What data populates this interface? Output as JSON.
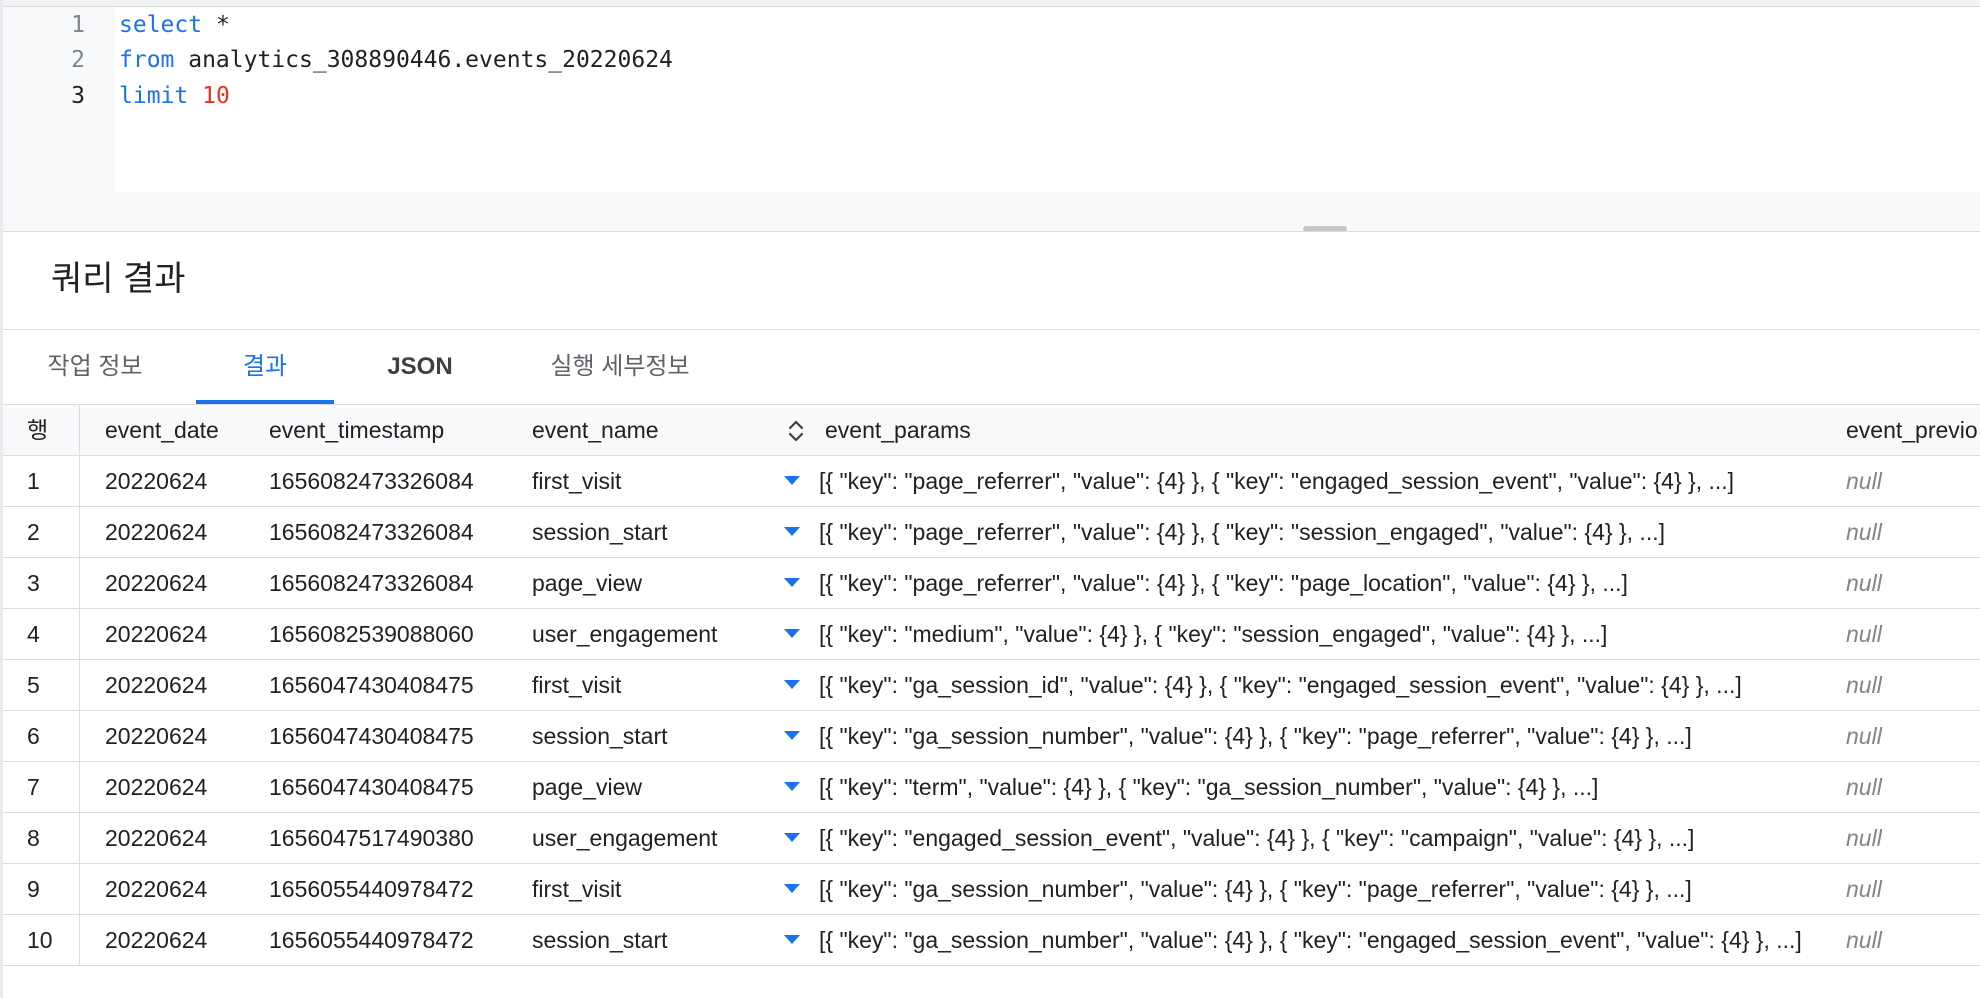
{
  "editor": {
    "lines": [
      {
        "num": "1",
        "kw1": "select",
        "rest": " *",
        "kw2": "",
        "numval": ""
      },
      {
        "num": "2",
        "kw1": "from",
        "rest": " analytics_308890446.events_20220624",
        "kw2": "",
        "numval": ""
      },
      {
        "num": "3",
        "kw1": "limit",
        "rest": " ",
        "kw2": "",
        "numval": "10"
      }
    ]
  },
  "results": {
    "title": "쿼리 결과"
  },
  "tabs": [
    {
      "label": "작업 정보"
    },
    {
      "label": "결과"
    },
    {
      "label": "JSON"
    },
    {
      "label": "실행 세부정보"
    }
  ],
  "table": {
    "headers": {
      "row": "행",
      "event_date": "event_date",
      "event_timestamp": "event_timestamp",
      "event_name": "event_name",
      "event_params": "event_params",
      "event_previous": "event_previo"
    },
    "rows": [
      {
        "row": "1",
        "event_date": "20220624",
        "event_timestamp": "1656082473326084",
        "event_name": "first_visit",
        "event_params": "[{ \"key\": \"page_referrer\", \"value\": {4} }, { \"key\": \"engaged_session_event\", \"value\": {4} }, ...]",
        "event_previous": "null"
      },
      {
        "row": "2",
        "event_date": "20220624",
        "event_timestamp": "1656082473326084",
        "event_name": "session_start",
        "event_params": "[{ \"key\": \"page_referrer\", \"value\": {4} }, { \"key\": \"session_engaged\", \"value\": {4} }, ...]",
        "event_previous": "null"
      },
      {
        "row": "3",
        "event_date": "20220624",
        "event_timestamp": "1656082473326084",
        "event_name": "page_view",
        "event_params": "[{ \"key\": \"page_referrer\", \"value\": {4} }, { \"key\": \"page_location\", \"value\": {4} }, ...]",
        "event_previous": "null"
      },
      {
        "row": "4",
        "event_date": "20220624",
        "event_timestamp": "1656082539088060",
        "event_name": "user_engagement",
        "event_params": "[{ \"key\": \"medium\", \"value\": {4} }, { \"key\": \"session_engaged\", \"value\": {4} }, ...]",
        "event_previous": "null"
      },
      {
        "row": "5",
        "event_date": "20220624",
        "event_timestamp": "1656047430408475",
        "event_name": "first_visit",
        "event_params": "[{ \"key\": \"ga_session_id\", \"value\": {4} }, { \"key\": \"engaged_session_event\", \"value\": {4} }, ...]",
        "event_previous": "null"
      },
      {
        "row": "6",
        "event_date": "20220624",
        "event_timestamp": "1656047430408475",
        "event_name": "session_start",
        "event_params": "[{ \"key\": \"ga_session_number\", \"value\": {4} }, { \"key\": \"page_referrer\", \"value\": {4} }, ...]",
        "event_previous": "null"
      },
      {
        "row": "7",
        "event_date": "20220624",
        "event_timestamp": "1656047430408475",
        "event_name": "page_view",
        "event_params": "[{ \"key\": \"term\", \"value\": {4} }, { \"key\": \"ga_session_number\", \"value\": {4} }, ...]",
        "event_previous": "null"
      },
      {
        "row": "8",
        "event_date": "20220624",
        "event_timestamp": "1656047517490380",
        "event_name": "user_engagement",
        "event_params": "[{ \"key\": \"engaged_session_event\", \"value\": {4} }, { \"key\": \"campaign\", \"value\": {4} }, ...]",
        "event_previous": "null"
      },
      {
        "row": "9",
        "event_date": "20220624",
        "event_timestamp": "1656055440978472",
        "event_name": "first_visit",
        "event_params": "[{ \"key\": \"ga_session_number\", \"value\": {4} }, { \"key\": \"page_referrer\", \"value\": {4} }, ...]",
        "event_previous": "null"
      },
      {
        "row": "10",
        "event_date": "20220624",
        "event_timestamp": "1656055440978472",
        "event_name": "session_start",
        "event_params": "[{ \"key\": \"ga_session_number\", \"value\": {4} }, { \"key\": \"engaged_session_event\", \"value\": {4} }, ...]",
        "event_previous": "null"
      }
    ]
  },
  "colors": {
    "accent": "#1a73e8",
    "number_literal": "#e8341c",
    "divider": "#dadce0",
    "null_text": "#80868b"
  },
  "icons": {
    "sort": "unfold-more-icon",
    "expand": "arrow-drop-down-icon"
  }
}
